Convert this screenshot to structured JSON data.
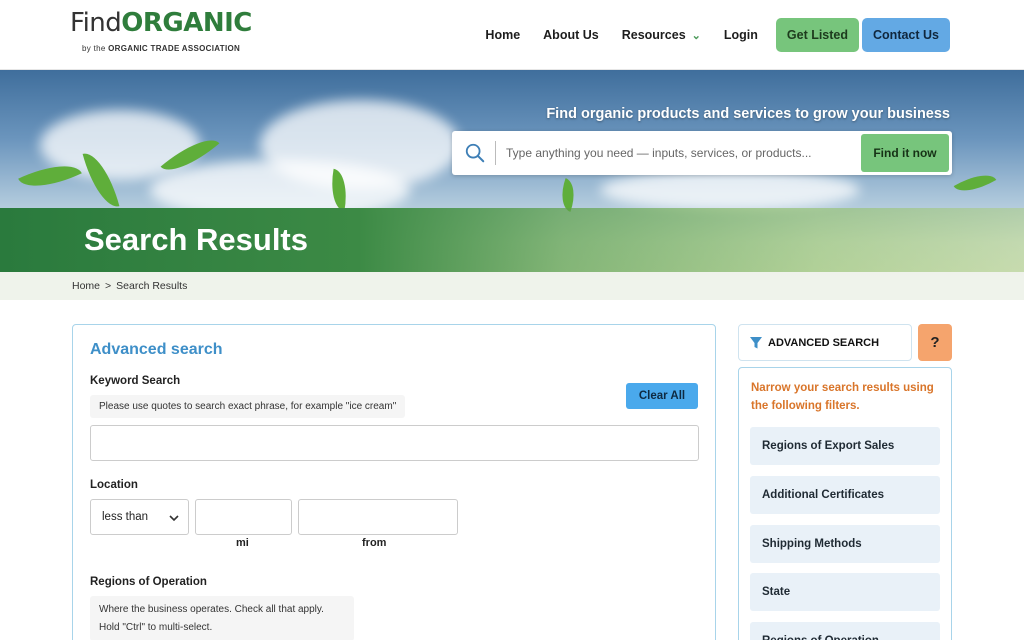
{
  "header": {
    "logo_find": "Find",
    "logo_organic": "ORGANIC",
    "logo_by": "by the",
    "logo_org": "ORGANIC TRADE ASSOCIATION",
    "nav": {
      "home": "Home",
      "about": "About Us",
      "resources": "Resources",
      "login": "Login",
      "get_listed": "Get Listed",
      "contact": "Contact Us"
    }
  },
  "hero": {
    "tagline": "Find organic products and services to grow your business",
    "search_placeholder": "Type anything you need — inputs, services, or products...",
    "search_button": "Find it now",
    "page_title": "Search Results"
  },
  "breadcrumb": {
    "home": "Home",
    "separator": ">",
    "current": "Search Results"
  },
  "advanced_search": {
    "title": "Advanced search",
    "keyword_label": "Keyword Search",
    "keyword_hint": "Please use quotes to search exact phrase, for example \"ice cream\"",
    "clear_all": "Clear All",
    "keyword_value": "",
    "location_label": "Location",
    "location_operator": "less than",
    "miles_value": "",
    "from_value": "",
    "miles_label": "mi",
    "from_label": "from",
    "regions_label": "Regions of Operation",
    "regions_hint_1": "Where the business operates. Check all that apply.",
    "regions_hint_2": "Hold \"Ctrl\" to multi-select."
  },
  "sidebar": {
    "header": "ADVANCED SEARCH",
    "help": "?",
    "intro": "Narrow your search results using the following filters.",
    "filters": [
      {
        "label": "Regions of Export Sales"
      },
      {
        "label": "Additional Certificates"
      },
      {
        "label": "Shipping Methods"
      },
      {
        "label": "State"
      },
      {
        "label": "Regions of Operation"
      }
    ]
  },
  "colors": {
    "brand_green": "#2f7d3c",
    "accent_green": "#77c57c",
    "accent_blue": "#63a9e4",
    "panel_title_blue": "#3e8fc8",
    "filter_intro_orange": "#d9752a",
    "help_orange": "#f5a46d"
  },
  "icons": {
    "search": "search-icon",
    "chevron": "chevron-down-icon",
    "filter": "filter-funnel-icon"
  }
}
